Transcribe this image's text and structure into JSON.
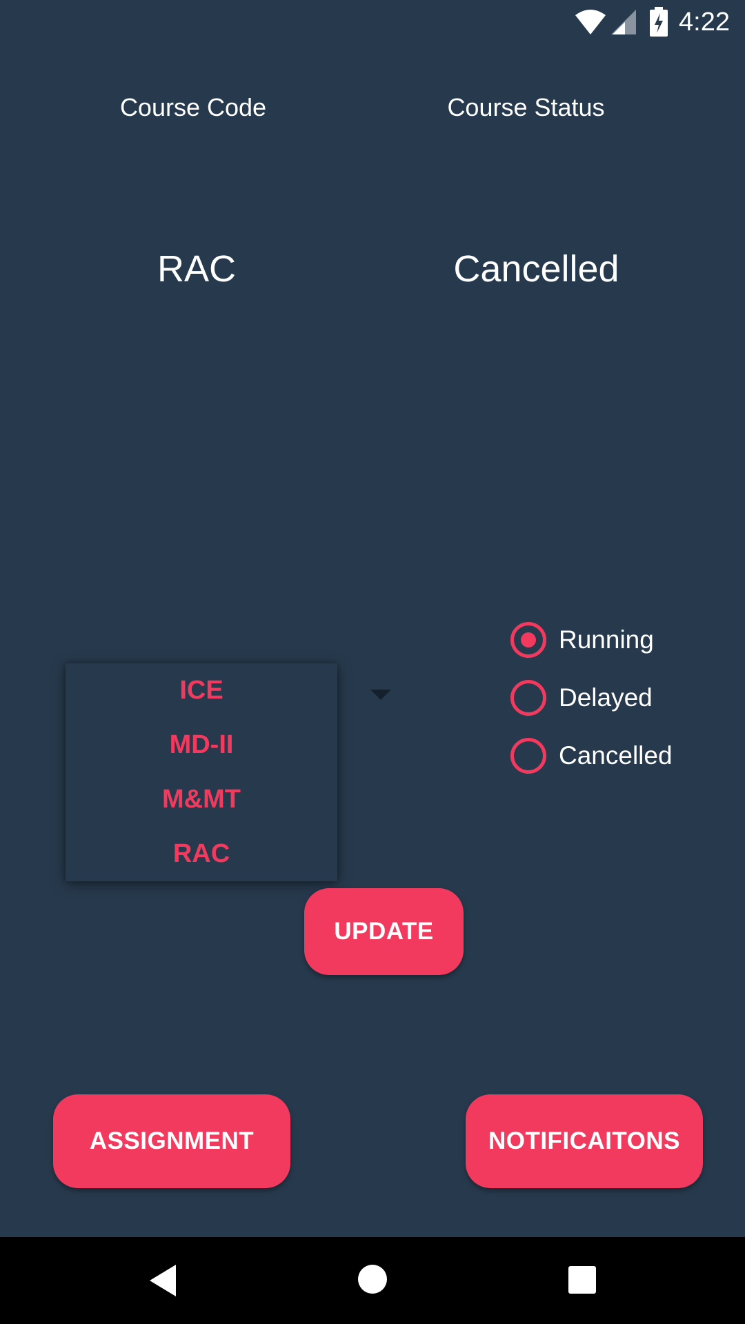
{
  "status_bar": {
    "time": "4:22",
    "icons": [
      "wifi-icon",
      "cell-signal-icon",
      "battery-charging-icon"
    ]
  },
  "headers": {
    "course_code": "Course Code",
    "course_status": "Course Status"
  },
  "current": {
    "code": "RAC",
    "status": "Cancelled"
  },
  "dropdown": {
    "items": [
      "ICE",
      "MD-II",
      "M&MT",
      "RAC"
    ]
  },
  "status_options": {
    "selected": "Running",
    "items": [
      "Running",
      "Delayed",
      "Cancelled"
    ]
  },
  "buttons": {
    "update": "UPDATE",
    "assignment": "ASSIGNMENT",
    "notifications": "NOTIFICAITONS"
  },
  "nav_bar": {
    "icons": [
      "back-icon",
      "home-icon",
      "recents-icon"
    ]
  },
  "colors": {
    "background": "#273a4d",
    "accent": "#f23a5f",
    "text": "#ffffff",
    "nav_bar": "#000000"
  }
}
